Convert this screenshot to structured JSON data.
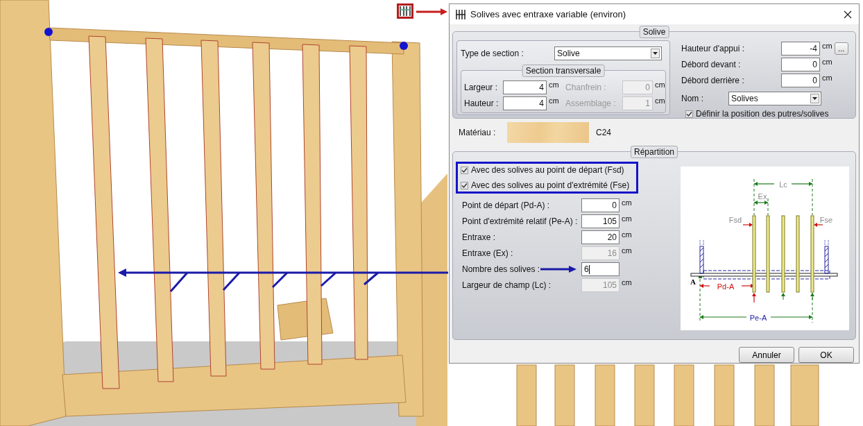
{
  "dialog": {
    "title": "Solives avec entraxe variable (environ)",
    "solive": {
      "legend": "Solive",
      "type_label": "Type de section :",
      "type_value": "Solive",
      "section": {
        "legend": "Section transversale",
        "fields": [
          {
            "label": "Largeur :",
            "value": "4",
            "unit": "cm",
            "disabled": false
          },
          {
            "label": "Chanfrein :",
            "value": "0",
            "unit": "cm",
            "disabled": true
          },
          {
            "label": "Hauteur :",
            "value": "4",
            "unit": "cm",
            "disabled": false
          },
          {
            "label": "Assemblage :",
            "value": "1",
            "unit": "cm",
            "disabled": true
          }
        ]
      },
      "right_fields": [
        {
          "label": "Hauteur d'appui :",
          "value": "-4",
          "unit": "cm",
          "more_button": "..."
        },
        {
          "label": "Débord devant :",
          "value": "0",
          "unit": "cm"
        },
        {
          "label": "Débord derrière :",
          "value": "0",
          "unit": "cm"
        }
      ],
      "nom": {
        "label": "Nom :",
        "value": "Solives"
      },
      "define_position": {
        "label": "Définir la position des putres/solives",
        "checked": true
      }
    },
    "material": {
      "label": "Matériau :",
      "name": "C24"
    },
    "repartition": {
      "legend": "Répartition",
      "checkboxes": [
        {
          "label": "Avec des solives au point de départ (Fsd)",
          "checked": true
        },
        {
          "label": "Avec des solives au point d'extrémité (Fse)",
          "checked": true
        }
      ],
      "fields": [
        {
          "label": "Point de départ (Pd-A) :",
          "value": "0",
          "unit": "cm",
          "disabled": false
        },
        {
          "label": "Point d'extrémité relatif (Pe-A) :",
          "value": "105",
          "unit": "cm",
          "disabled": false
        },
        {
          "label": "Entraxe :",
          "value": "20",
          "unit": "cm",
          "disabled": false
        },
        {
          "label": "Entraxe (Ex) :",
          "value": "16",
          "unit": "cm",
          "disabled": true
        },
        {
          "label": "Nombre des solives :",
          "value": "6",
          "disabled": false,
          "focused": true
        },
        {
          "label": "Largeur de champ (Lc) :",
          "value": "105",
          "unit": "cm",
          "disabled": true
        }
      ],
      "diagram": {
        "lc": "Lc",
        "ex": "Ex",
        "fsd": "Fsd",
        "fse": "Fse",
        "origin": "A",
        "pd_a": "Pd-A",
        "pe_a": "Pe-A"
      }
    },
    "buttons": [
      "Annuler",
      "OK"
    ]
  }
}
